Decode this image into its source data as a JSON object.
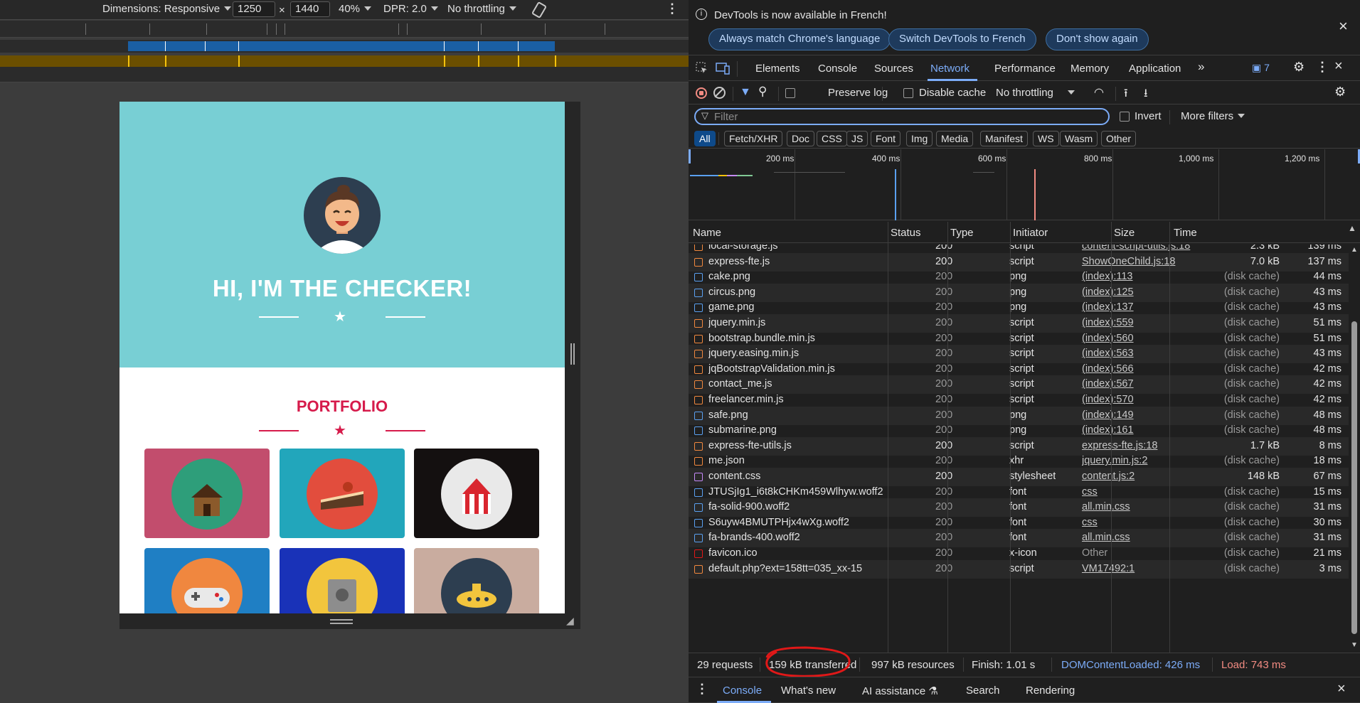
{
  "device_toolbar": {
    "dimensions_label": "Dimensions: Responsive",
    "width": "1250",
    "times": "×",
    "height": "1440",
    "zoom": "40%",
    "dpr": "DPR: 2.0",
    "throttling": "No throttling"
  },
  "page": {
    "hero_title": "HI, I'M THE CHECKER!",
    "portfolio_title": "PORTFOLIO",
    "hero_bg": "#78cfd4",
    "accent": "#d61b4b"
  },
  "infobar": {
    "message": "DevTools is now available in French!",
    "buttons": [
      "Always match Chrome's language",
      "Switch DevTools to French",
      "Don't show again"
    ]
  },
  "tabs": {
    "items": [
      "Elements",
      "Console",
      "Sources",
      "Network",
      "Performance",
      "Memory",
      "Application"
    ],
    "active": "Network",
    "issues_count": "7"
  },
  "network_toolbar": {
    "preserve_log": "Preserve log",
    "disable_cache": "Disable cache",
    "throttling": "No throttling"
  },
  "filter": {
    "placeholder": "Filter",
    "invert": "Invert",
    "more_filters": "More filters"
  },
  "type_filters": [
    "All",
    "Fetch/XHR",
    "Doc",
    "CSS",
    "JS",
    "Font",
    "Img",
    "Media",
    "Manifest",
    "WS",
    "Wasm",
    "Other"
  ],
  "overview_ticks": [
    "200 ms",
    "400 ms",
    "600 ms",
    "800 ms",
    "1,000 ms",
    "1,200 ms"
  ],
  "columns": [
    "Name",
    "Status",
    "Type",
    "Initiator",
    "Size",
    "Time"
  ],
  "requests": [
    {
      "name": "local-storage.js",
      "status": "200",
      "type": "script",
      "initiator": "content-script-utils.js:18",
      "size": "2.3 kB",
      "time": "139 ms",
      "icon": "script-icon",
      "dim": false
    },
    {
      "name": "express-fte.js",
      "status": "200",
      "type": "script",
      "initiator": "ShowOneChild.js:18",
      "size": "7.0 kB",
      "time": "137 ms",
      "icon": "script-icon",
      "dim": false
    },
    {
      "name": "cake.png",
      "status": "200",
      "type": "png",
      "initiator": "(index):113",
      "size": "(disk cache)",
      "time": "44 ms",
      "icon": "image-icon",
      "dim": true
    },
    {
      "name": "circus.png",
      "status": "200",
      "type": "png",
      "initiator": "(index):125",
      "size": "(disk cache)",
      "time": "43 ms",
      "icon": "image-icon",
      "dim": true
    },
    {
      "name": "game.png",
      "status": "200",
      "type": "png",
      "initiator": "(index):137",
      "size": "(disk cache)",
      "time": "43 ms",
      "icon": "image-icon",
      "dim": true
    },
    {
      "name": "jquery.min.js",
      "status": "200",
      "type": "script",
      "initiator": "(index):559",
      "size": "(disk cache)",
      "time": "51 ms",
      "icon": "script-icon",
      "dim": true
    },
    {
      "name": "bootstrap.bundle.min.js",
      "status": "200",
      "type": "script",
      "initiator": "(index):560",
      "size": "(disk cache)",
      "time": "51 ms",
      "icon": "script-icon",
      "dim": true
    },
    {
      "name": "jquery.easing.min.js",
      "status": "200",
      "type": "script",
      "initiator": "(index):563",
      "size": "(disk cache)",
      "time": "43 ms",
      "icon": "script-icon",
      "dim": true
    },
    {
      "name": "jqBootstrapValidation.min.js",
      "status": "200",
      "type": "script",
      "initiator": "(index):566",
      "size": "(disk cache)",
      "time": "42 ms",
      "icon": "script-icon",
      "dim": true
    },
    {
      "name": "contact_me.js",
      "status": "200",
      "type": "script",
      "initiator": "(index):567",
      "size": "(disk cache)",
      "time": "42 ms",
      "icon": "script-icon",
      "dim": true
    },
    {
      "name": "freelancer.min.js",
      "status": "200",
      "type": "script",
      "initiator": "(index):570",
      "size": "(disk cache)",
      "time": "42 ms",
      "icon": "script-icon",
      "dim": true
    },
    {
      "name": "safe.png",
      "status": "200",
      "type": "png",
      "initiator": "(index):149",
      "size": "(disk cache)",
      "time": "48 ms",
      "icon": "image-icon",
      "dim": true
    },
    {
      "name": "submarine.png",
      "status": "200",
      "type": "png",
      "initiator": "(index):161",
      "size": "(disk cache)",
      "time": "48 ms",
      "icon": "image-icon",
      "dim": true
    },
    {
      "name": "express-fte-utils.js",
      "status": "200",
      "type": "script",
      "initiator": "express-fte.js:18",
      "size": "1.7 kB",
      "time": "8 ms",
      "icon": "script-icon",
      "dim": false
    },
    {
      "name": "me.json",
      "status": "200",
      "type": "xhr",
      "initiator": "jquery.min.js:2",
      "size": "(disk cache)",
      "time": "18 ms",
      "icon": "json-icon",
      "dim": true
    },
    {
      "name": "content.css",
      "status": "200",
      "type": "stylesheet",
      "initiator": "content.js:2",
      "size": "148 kB",
      "time": "67 ms",
      "icon": "stylesheet-icon",
      "dim": false
    },
    {
      "name": "JTUSjIg1_i6t8kCHKm459Wlhyw.woff2",
      "status": "200",
      "type": "font",
      "initiator": "css",
      "size": "(disk cache)",
      "time": "15 ms",
      "icon": "font-icon",
      "dim": true
    },
    {
      "name": "fa-solid-900.woff2",
      "status": "200",
      "type": "font",
      "initiator": "all.min.css",
      "size": "(disk cache)",
      "time": "31 ms",
      "icon": "font-icon",
      "dim": true
    },
    {
      "name": "S6uyw4BMUTPHjx4wXg.woff2",
      "status": "200",
      "type": "font",
      "initiator": "css",
      "size": "(disk cache)",
      "time": "30 ms",
      "icon": "font-icon",
      "dim": true
    },
    {
      "name": "fa-brands-400.woff2",
      "status": "200",
      "type": "font",
      "initiator": "all.min.css",
      "size": "(disk cache)",
      "time": "31 ms",
      "icon": "font-icon",
      "dim": true
    },
    {
      "name": "favicon.ico",
      "status": "200",
      "type": "x-icon",
      "initiator": "Other",
      "size": "(disk cache)",
      "time": "21 ms",
      "icon": "favicon-icon",
      "dim": true
    },
    {
      "name": "default.php?ext=158tt=035_xx-15",
      "status": "200",
      "type": "script",
      "initiator": "VM17492:1",
      "size": "(disk cache)",
      "time": "3 ms",
      "icon": "script-icon",
      "dim": true
    }
  ],
  "status_bar": {
    "requests": "29 requests",
    "transferred": "159 kB transferred",
    "resources": "997 kB resources",
    "finish": "Finish: 1.01 s",
    "dom_loaded": "DOMContentLoaded: 426 ms",
    "load": "Load: 743 ms"
  },
  "drawer": {
    "tabs": [
      "Console",
      "What's new",
      "AI assistance",
      "Search",
      "Rendering"
    ],
    "active": "Console"
  }
}
